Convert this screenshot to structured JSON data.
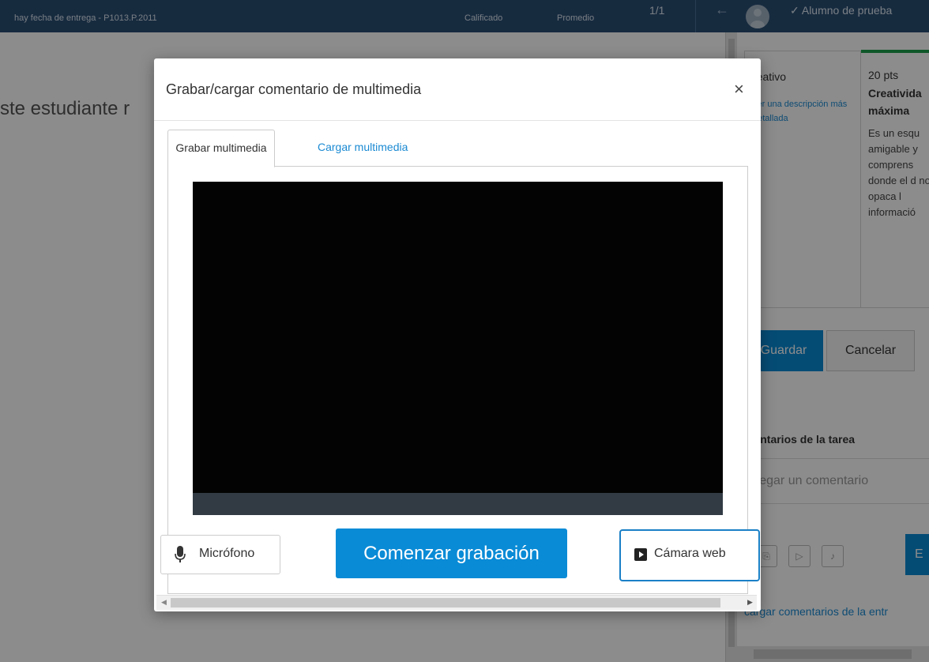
{
  "topbar": {
    "subtitle": "hay fecha de entrega - P1013.P.2011",
    "stat_graded": "Calificado",
    "stat_average": "Promedio",
    "count": "1/1",
    "arrow": "←",
    "student_check": "✓",
    "student_name": "Alumno de prueba"
  },
  "background": {
    "left_text": "ste estudiante r"
  },
  "rubric": {
    "criterion_title": "reativo",
    "criterion_link": "ver una descripción más detallada",
    "points": "20 pts",
    "level_title": "Creativida máxima",
    "level_description": "Es un esqu amigable y comprens donde el d no opaca l informació"
  },
  "actions": {
    "save": "Guardar",
    "cancel": "Cancelar"
  },
  "comments": {
    "title": "mentarios de la tarea",
    "placeholder": "gregar un comentario",
    "submit_partial": "E",
    "download_link": "cargar comentarios de la entr"
  },
  "modal": {
    "title": "Grabar/cargar comentario de multimedia",
    "close": "×",
    "tabs": [
      {
        "label": "Grabar multimedia",
        "active": true
      },
      {
        "label": "Cargar multimedia",
        "active": false
      }
    ],
    "mic_label": "Micrófono",
    "record_label": "Comenzar grabación",
    "webcam_label": "Cámara web"
  },
  "colors": {
    "primary": "#0a8bd6",
    "topbar": "#2a4f74",
    "link": "#1b8ad3",
    "rubric_selected": "#1c9e4a"
  }
}
